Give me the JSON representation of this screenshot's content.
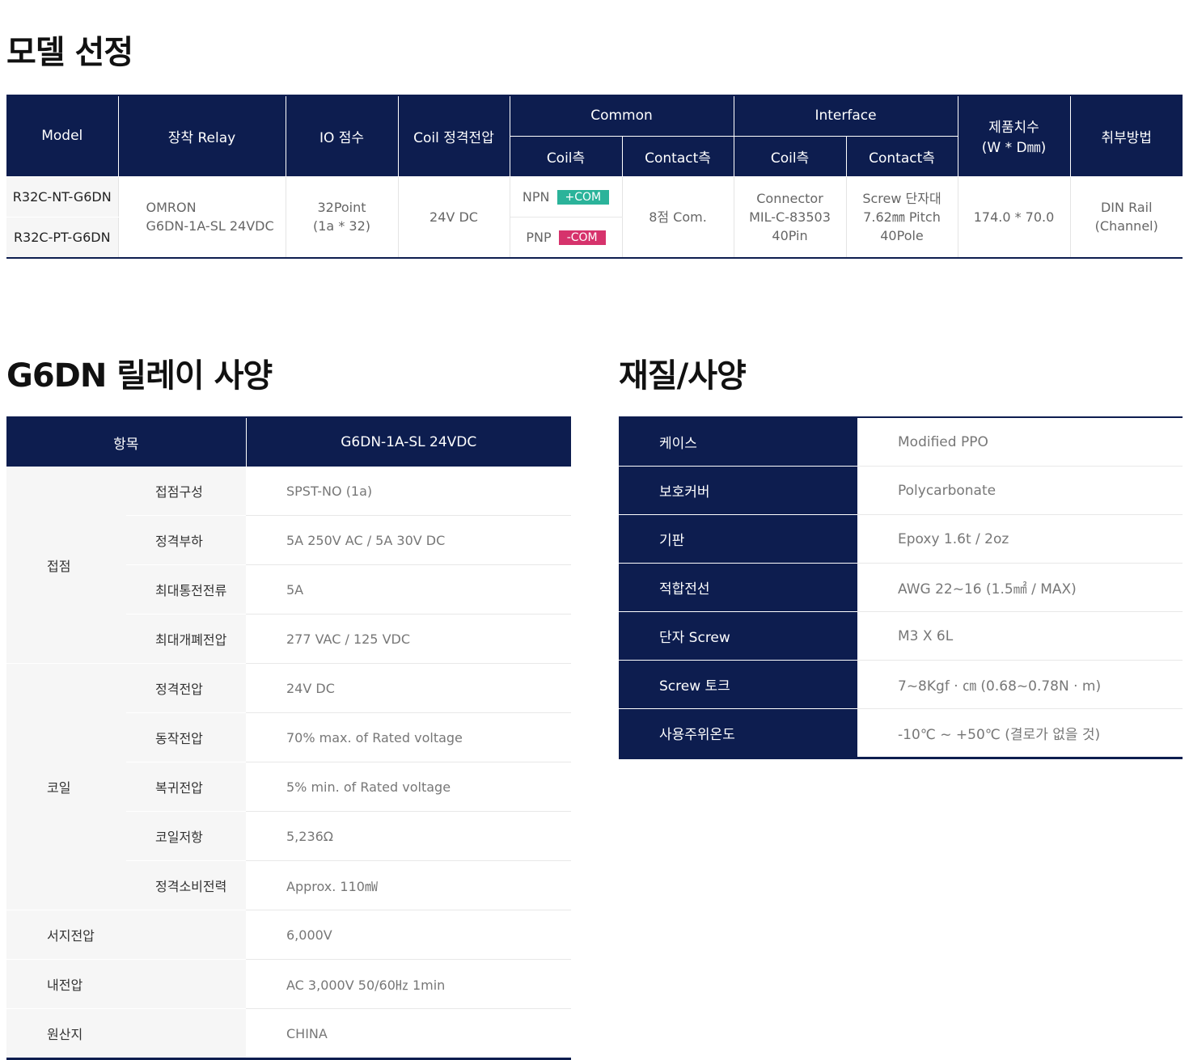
{
  "model_section": {
    "title": "모델 선정",
    "headers": {
      "model": "Model",
      "relay": "장착 Relay",
      "io": "IO 점수",
      "coil_voltage": "Coil 정격전압",
      "common": "Common",
      "interface": "Interface",
      "common_coil": "Coil측",
      "common_contact": "Contact측",
      "interface_coil": "Coil측",
      "interface_contact": "Contact측",
      "dimension_line1": "제품치수",
      "dimension_line2": "(W * D㎜)",
      "mounting": "취부방법"
    },
    "rows": [
      {
        "model": "R32C-NT-G6DN",
        "type": "NPN",
        "tag": "+COM"
      },
      {
        "model": "R32C-PT-G6DN",
        "type": "PNP",
        "tag": "-COM"
      }
    ],
    "shared": {
      "relay_line1": "OMRON",
      "relay_line2": "G6DN-1A-SL 24VDC",
      "io_line1": "32Point",
      "io_line2": "(1a * 32)",
      "coil_voltage": "24V DC",
      "common_contact": "8점 Com.",
      "interface_coil_line1": "Connector",
      "interface_coil_line2": "MIL-C-83503",
      "interface_coil_line3": "40Pin",
      "interface_contact_line1": "Screw 단자대",
      "interface_contact_line2": "7.62㎜ Pitch",
      "interface_contact_line3": "40Pole",
      "dimension": "174.0 * 70.0",
      "mounting_line1": "DIN Rail",
      "mounting_line2": "(Channel)"
    },
    "colors": {
      "navy": "#0d1d4f",
      "npn_tag": "#2bb39a",
      "pnp_tag": "#d6336c"
    }
  },
  "spec_section": {
    "title": "G6DN 릴레이 사양",
    "header_item": "항목",
    "header_model": "G6DN-1A-SL 24VDC",
    "contact_group": "접점",
    "contact_rows": [
      {
        "label": "접점구성",
        "value": "SPST-NO (1a)"
      },
      {
        "label": "정격부하",
        "value": "5A 250V AC / 5A 30V DC"
      },
      {
        "label": "최대통전전류",
        "value": "5A"
      },
      {
        "label": "최대개폐전압",
        "value": "277 VAC / 125 VDC"
      }
    ],
    "coil_group": "코일",
    "coil_rows": [
      {
        "label": "정격전압",
        "value": "24V DC"
      },
      {
        "label": "동작전압",
        "value": "70% max. of Rated voltage"
      },
      {
        "label": "복귀전압",
        "value": "5% min. of Rated voltage"
      },
      {
        "label": "코일저항",
        "value": "5,236Ω"
      },
      {
        "label": "정격소비전력",
        "value": "Approx. 110㎽"
      }
    ],
    "single_rows": [
      {
        "label": "서지전압",
        "value": "6,000V"
      },
      {
        "label": "내전압",
        "value": "AC 3,000V 50/60㎐ 1min"
      },
      {
        "label": "원산지",
        "value": "CHINA"
      }
    ]
  },
  "material_section": {
    "title": "재질/사양",
    "rows": [
      {
        "label": "케이스",
        "value": "Modified PPO"
      },
      {
        "label": "보호커버",
        "value": "Polycarbonate"
      },
      {
        "label": "기판",
        "value": "Epoxy 1.6t / 2oz"
      },
      {
        "label": "적합전선",
        "value": "AWG 22~16 (1.5㎟ / MAX)"
      },
      {
        "label": "단자 Screw",
        "value": "M3 X 6L"
      },
      {
        "label": "Screw 토크",
        "value": "7~8Kgf · ㎝ (0.68~0.78N · m)"
      },
      {
        "label": "사용주위온도",
        "value": "-10℃ ~ +50℃ (결로가 없을 것)"
      }
    ]
  }
}
